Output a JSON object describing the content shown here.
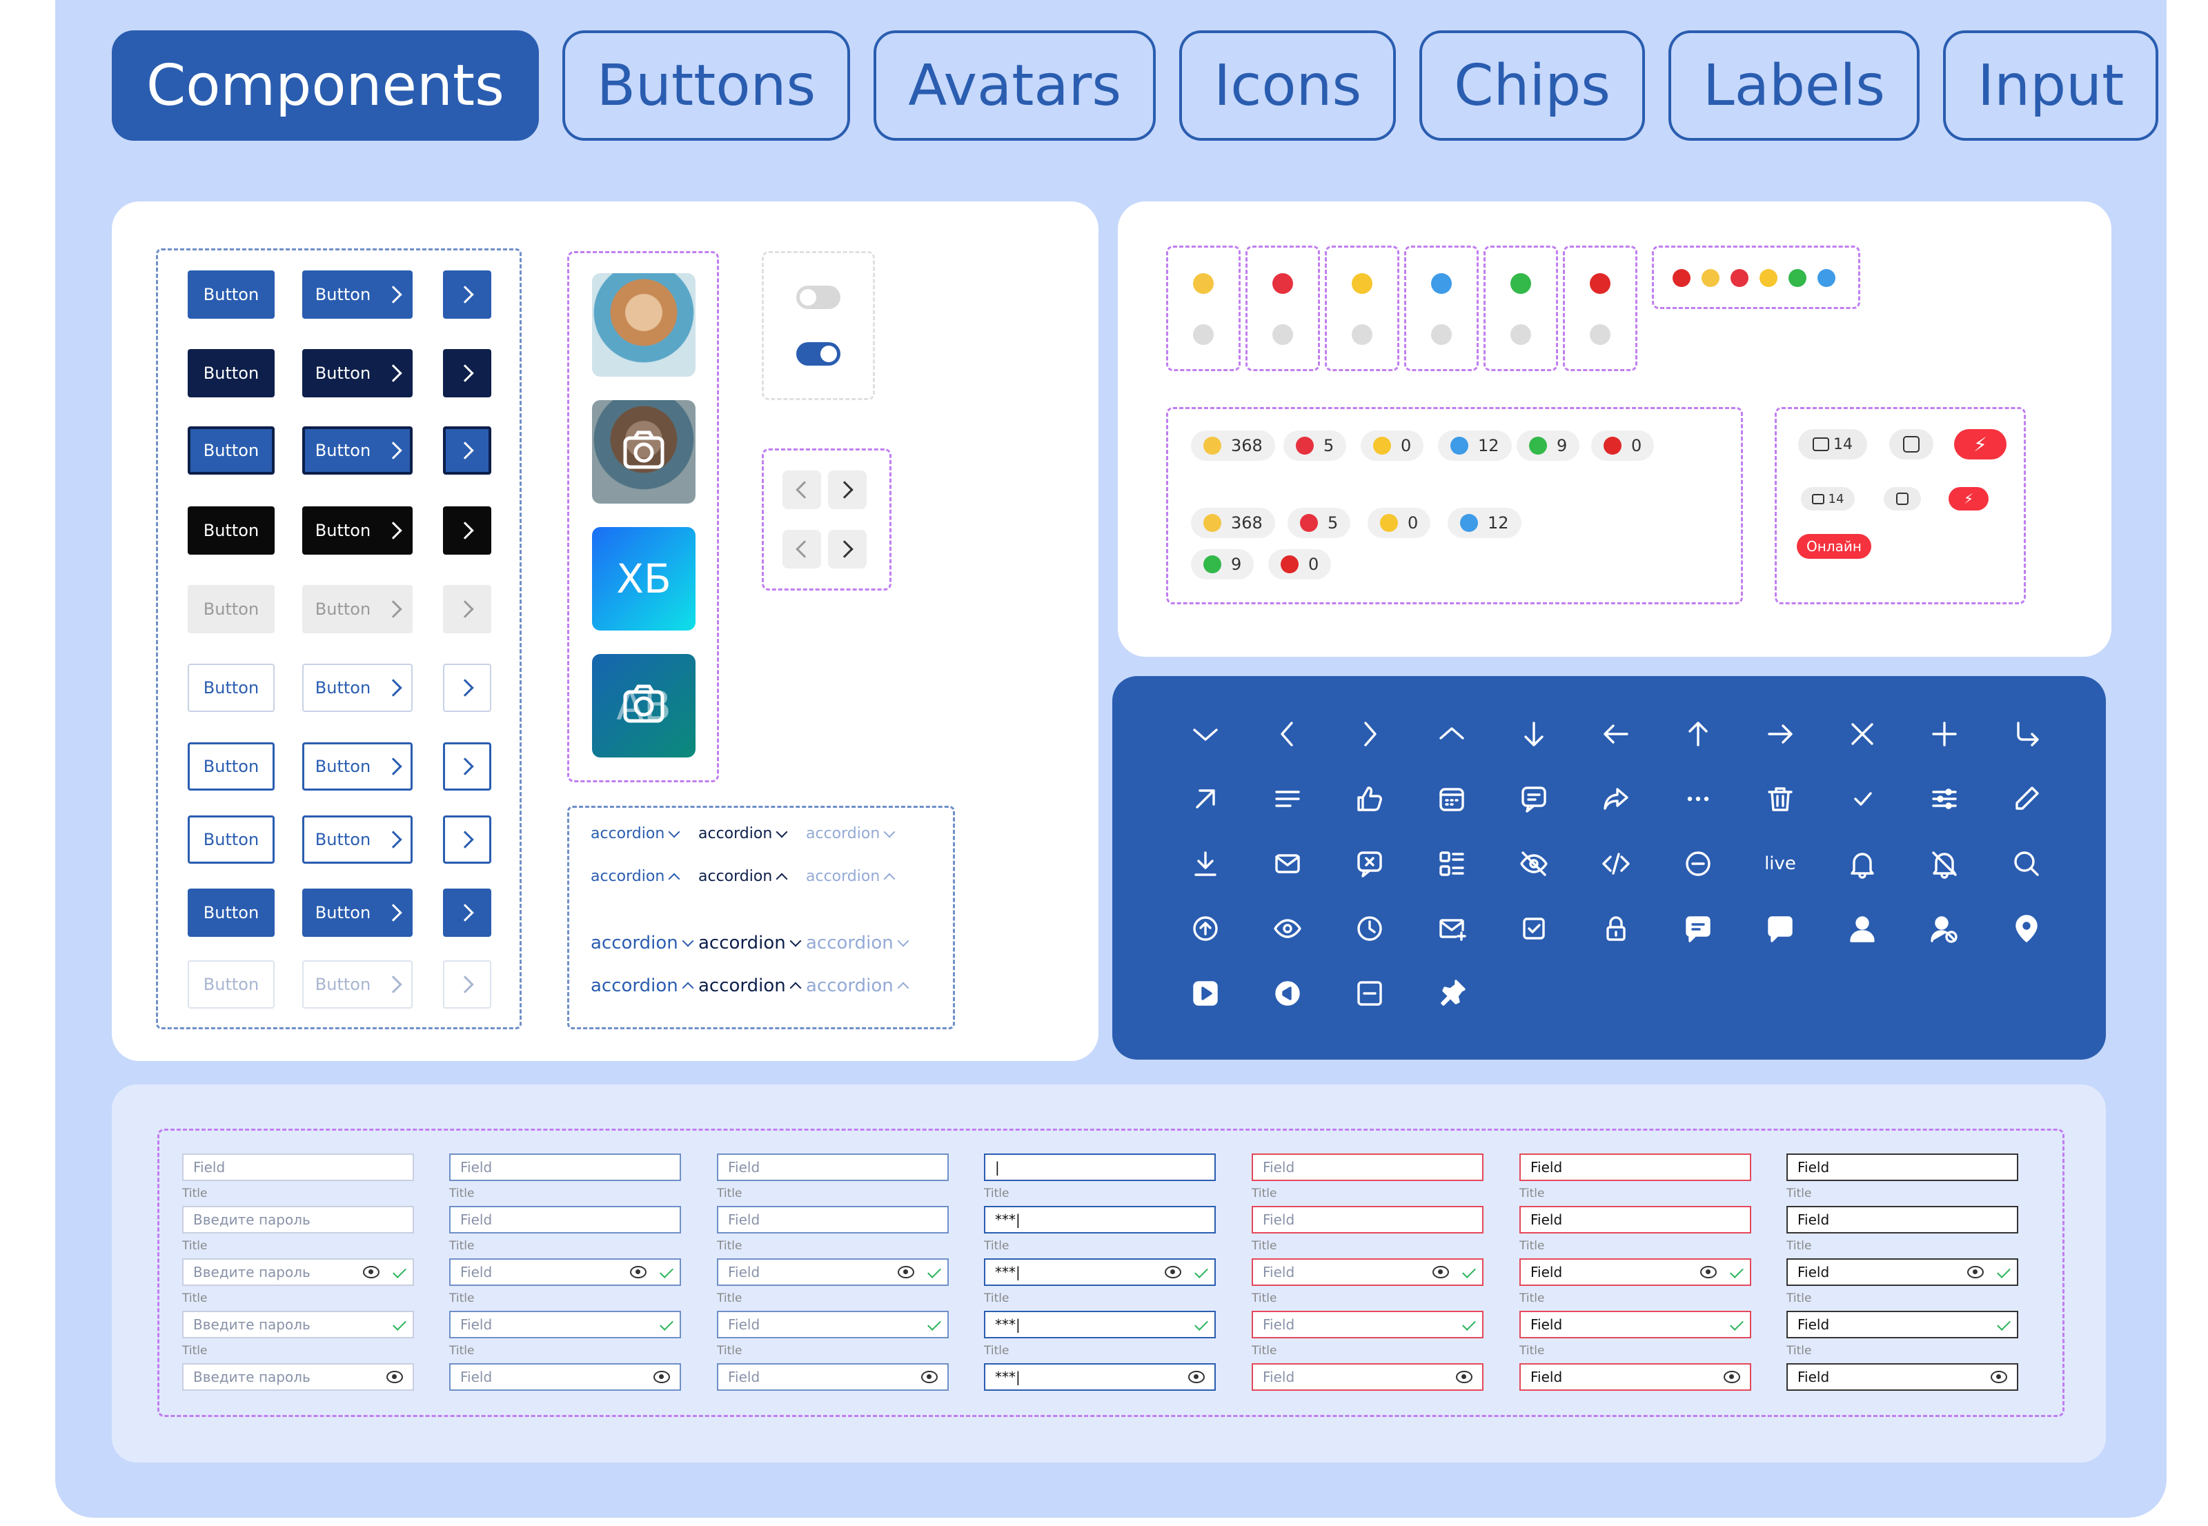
{
  "tabs": [
    {
      "label": "Components",
      "active": true
    },
    {
      "label": "Buttons",
      "active": false
    },
    {
      "label": "Avatars",
      "active": false
    },
    {
      "label": "Icons",
      "active": false
    },
    {
      "label": "Chips",
      "active": false
    },
    {
      "label": "Labels",
      "active": false
    },
    {
      "label": "Input",
      "active": false
    }
  ],
  "buttons": {
    "label": "Button"
  },
  "avatars": {
    "initials": "ХБ",
    "overlay": "АВ"
  },
  "accordion": {
    "label": "accordion"
  },
  "reactions_row1": {
    "like": "368",
    "dislike": "5",
    "smile": "0",
    "sad": "12",
    "angry": "9",
    "mad": "0"
  },
  "reactions_row2": {
    "like": "368",
    "dislike": "5",
    "smile": "0",
    "sad": "12"
  },
  "reactions_row3": {
    "angry": "9",
    "mad": "0"
  },
  "media_chips": {
    "photo_count": "14",
    "photo_count_small": "14",
    "online": "Онлайн"
  },
  "icons": {
    "live": "live"
  },
  "inputs": {
    "placeholder": "Field",
    "password_placeholder": "Введите пароль",
    "title": "Title",
    "masked": "***|",
    "cursor": "|"
  },
  "colors": {
    "primary": "#2a5db0",
    "dark": "#0d1f4a",
    "danger": "#f5323e",
    "background": "#c6d8fb"
  }
}
